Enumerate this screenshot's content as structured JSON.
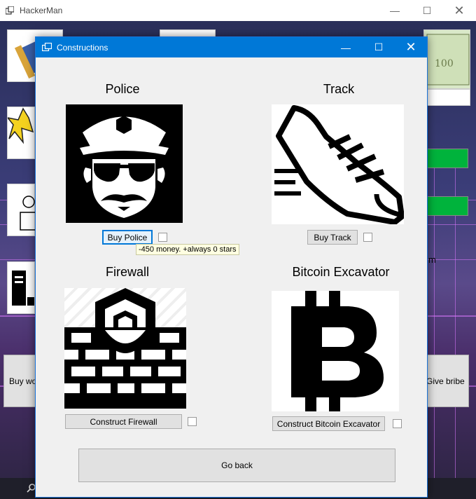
{
  "main_window": {
    "title": "HackerMan",
    "background_buttons": {
      "left_label": "Buy wo",
      "right_label": "Give bribe"
    },
    "partial_text": "m"
  },
  "dialog": {
    "title": "Constructions",
    "sections": {
      "police": {
        "title": "Police",
        "button": "Buy Police",
        "tooltip": "-450 money. +always 0 stars"
      },
      "track": {
        "title": "Track",
        "button": "Buy Track"
      },
      "firewall": {
        "title": "Firewall",
        "button": "Construct Firewall"
      },
      "bitcoin": {
        "title": "Bitcoin Excavator",
        "button": "Construct Bitcoin Excavator"
      }
    },
    "go_back": "Go back"
  },
  "icons": {
    "minimize": "minimize-icon",
    "maximize": "maximize-icon",
    "close": "close-icon",
    "police": "police-officer-icon",
    "track": "running-shoe-icon",
    "firewall": "firewall-shield-icon",
    "bitcoin": "bitcoin-icon"
  }
}
